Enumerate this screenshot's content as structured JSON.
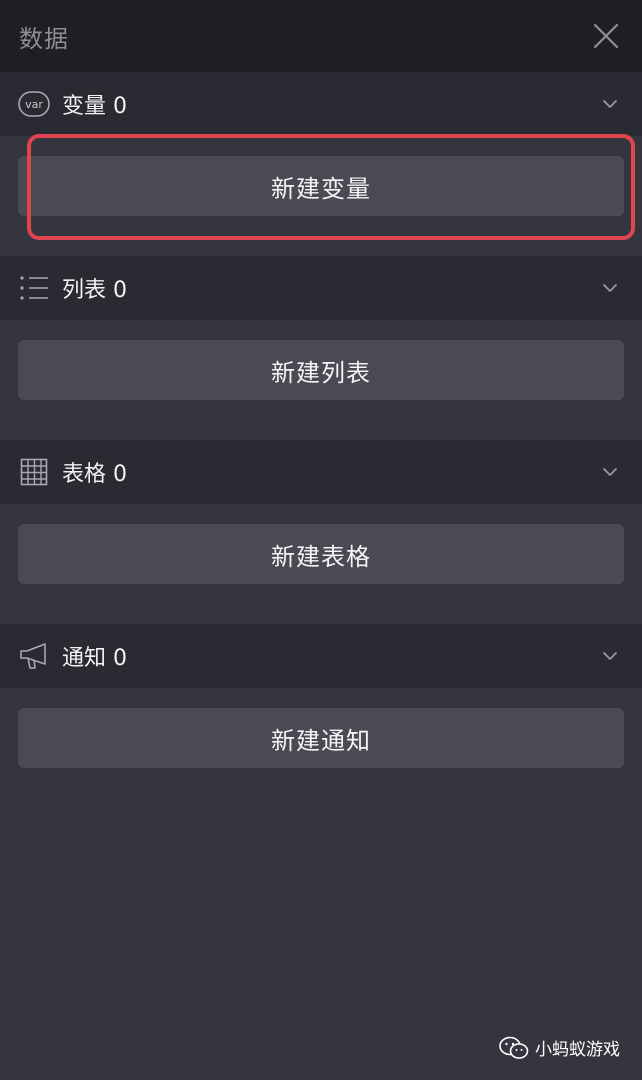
{
  "header": {
    "title": "数据"
  },
  "sections": [
    {
      "icon": "var-icon",
      "label": "变量 0",
      "button_label": "新建变量"
    },
    {
      "icon": "list-icon",
      "label": "列表 0",
      "button_label": "新建列表"
    },
    {
      "icon": "table-icon",
      "label": "表格 0",
      "button_label": "新建表格"
    },
    {
      "icon": "megaphone-icon",
      "label": "通知 0",
      "button_label": "新建通知"
    }
  ],
  "watermark": {
    "text": "小蚂蚁游戏"
  },
  "colors": {
    "background": "#35353f",
    "header_bg": "#1e1e25",
    "section_header_bg": "#2a2a32",
    "button_bg": "#4a4a54",
    "highlight": "#e0454f"
  }
}
